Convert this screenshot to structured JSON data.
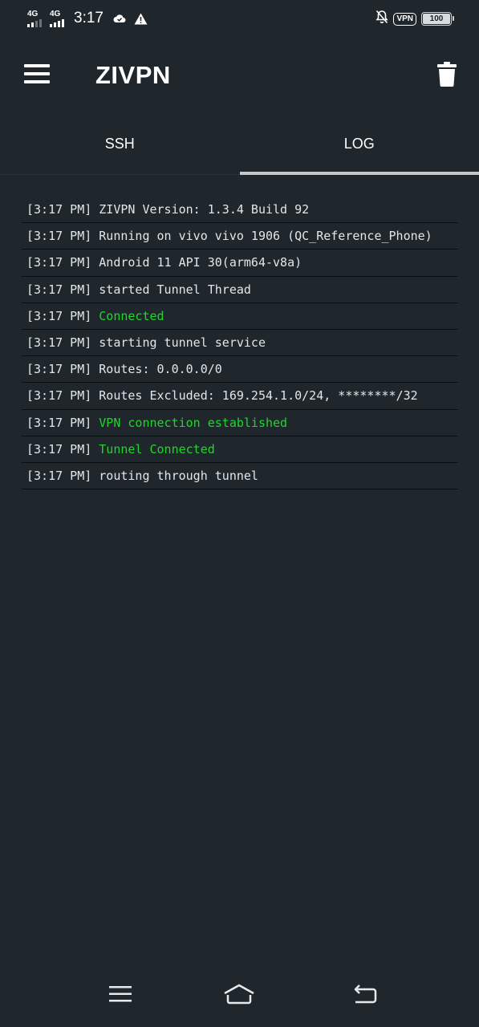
{
  "status_bar": {
    "sim1_network": "4G",
    "sim2_network": "4G",
    "time": "3:17",
    "icons": [
      "cloud-icon",
      "warning-icon",
      "bell-off-icon"
    ],
    "vpn_label": "VPN",
    "battery_level": "100"
  },
  "app_bar": {
    "title": "ZIVPN",
    "menu_icon": "hamburger-menu-icon",
    "delete_icon": "trash-icon"
  },
  "tabs": [
    {
      "label": "SSH",
      "active": false
    },
    {
      "label": "LOG",
      "active": true
    }
  ],
  "log": [
    {
      "time": "[3:17 PM]",
      "message": "ZIVPN Version: 1.3.4 Build 92",
      "color": "#e3e6e8"
    },
    {
      "time": "[3:17 PM]",
      "message": "Running on vivo vivo 1906 (QC_Reference_Phone)",
      "color": "#e3e6e8"
    },
    {
      "time": "[3:17 PM]",
      "message": "Android 11 API 30(arm64-v8a)",
      "color": "#e3e6e8"
    },
    {
      "time": "[3:17 PM]",
      "message": "started Tunnel Thread",
      "color": "#e3e6e8"
    },
    {
      "time": "[3:17 PM]",
      "message": "Connected",
      "color": "#22d52c"
    },
    {
      "time": "[3:17 PM]",
      "message": "starting tunnel service",
      "color": "#e3e6e8"
    },
    {
      "time": "[3:17 PM]",
      "message": "Routes: 0.0.0.0/0",
      "color": "#e3e6e8"
    },
    {
      "time": "[3:17 PM]",
      "message": "Routes Excluded: 169.254.1.0/24, ********/32",
      "color": "#e3e6e8"
    },
    {
      "time": "[3:17 PM]",
      "message": "VPN connection established",
      "color": "#22d52c"
    },
    {
      "time": "[3:17 PM]",
      "message": "Tunnel Connected",
      "color": "#22d52c"
    },
    {
      "time": "[3:17 PM]",
      "message": "routing through tunnel",
      "color": "#e3e6e8"
    }
  ],
  "nav_bar": {
    "icons": [
      "recent-apps-icon",
      "home-icon",
      "back-icon"
    ]
  },
  "colors": {
    "background": "#20272c",
    "success_text": "#22d52c",
    "tab_indicator": "#c4c8cb"
  }
}
